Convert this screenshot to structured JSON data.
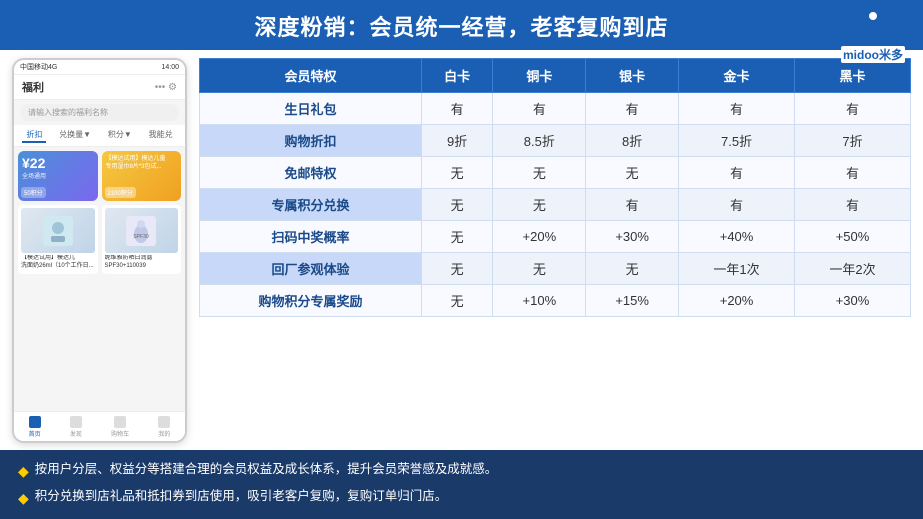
{
  "header": {
    "title": "深度粉销：会员统一经营，老客复购到店",
    "logo_brand": "midoo米多"
  },
  "phone": {
    "status_bar": "中国移动4G",
    "time": "14:00",
    "nav_title": "福利",
    "search_placeholder": "请输入搜索的福利名称",
    "tabs": [
      "折扣",
      "兑换量▼",
      "积分▼",
      "我能兑"
    ],
    "active_tab": "折扣",
    "coupon1_price": "¥22",
    "coupon1_label": "全场通用",
    "coupon1_points": "50积分",
    "coupon2_label": "模达儿童\n专用湿巾8片*3包试...",
    "coupon2_points": "2100积分",
    "product1_label": "【模达试用】模达儿\n洗面奶26ml（10个工作日...",
    "product2_label": "妮维雅防晒白润露\nSPF30+110039",
    "bottom_nav": [
      "首页",
      "发现",
      "购物车",
      "我的"
    ]
  },
  "table": {
    "headers": [
      "会员特权",
      "白卡",
      "铜卡",
      "银卡",
      "金卡",
      "黑卡"
    ],
    "rows": [
      [
        "生日礼包",
        "有",
        "有",
        "有",
        "有",
        "有"
      ],
      [
        "购物折扣",
        "9折",
        "8.5折",
        "8折",
        "7.5折",
        "7折"
      ],
      [
        "免邮特权",
        "无",
        "无",
        "无",
        "有",
        "有"
      ],
      [
        "专属积分兑换",
        "无",
        "无",
        "有",
        "有",
        "有"
      ],
      [
        "扫码中奖概率",
        "无",
        "+20%",
        "+30%",
        "+40%",
        "+50%"
      ],
      [
        "回厂参观体验",
        "无",
        "无",
        "无",
        "一年1次",
        "一年2次"
      ],
      [
        "购物积分专属奖励",
        "无",
        "+10%",
        "+15%",
        "+20%",
        "+30%"
      ]
    ]
  },
  "footer": {
    "bullets": [
      "按用户分层、权益分等搭建合理的会员权益及成长体系，提升会员荣誉感及成就感。",
      "积分兑换到店礼品和抵扣券到店使用，吸引老客户复购，复购订单归门店。"
    ]
  }
}
